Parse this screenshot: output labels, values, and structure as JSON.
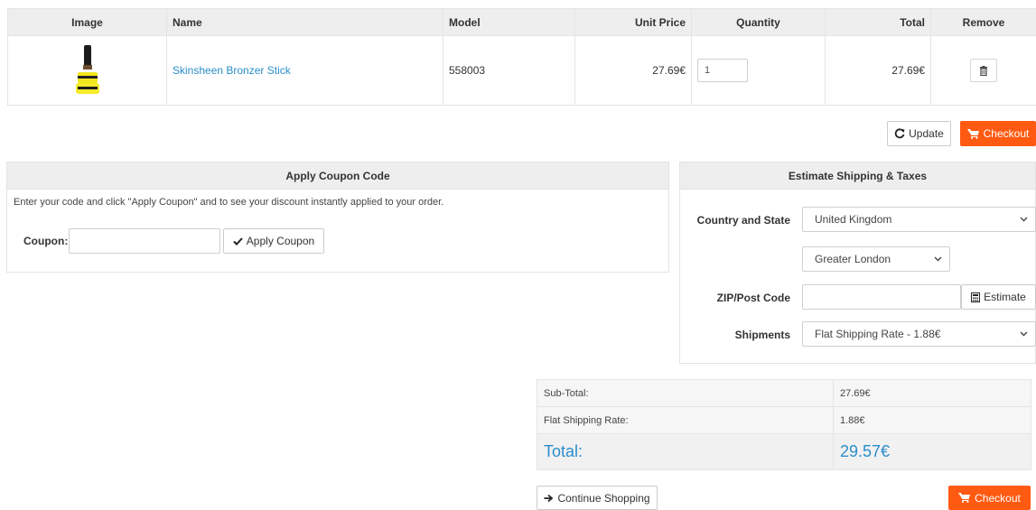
{
  "cart": {
    "headers": {
      "image": "Image",
      "name": "Name",
      "model": "Model",
      "unit_price": "Unit Price",
      "quantity": "Quantity",
      "total": "Total",
      "remove": "Remove"
    },
    "items": [
      {
        "name": "Skinsheen Bronzer Stick",
        "model": "558003",
        "unit_price": "27.69€",
        "quantity": "1",
        "total": "27.69€"
      }
    ],
    "update_label": "Update",
    "checkout_label": "Checkout"
  },
  "coupon": {
    "title": "Apply Coupon Code",
    "description": "Enter your code and click \"Apply Coupon\" and to see your discount instantly applied to your order.",
    "field_label": "Coupon:",
    "value": "",
    "button_label": "Apply Coupon"
  },
  "shipping": {
    "title": "Estimate Shipping & Taxes",
    "country_label": "Country and State",
    "country_value": "United Kingdom",
    "state_value": "Greater London",
    "zip_label": "ZIP/Post Code",
    "zip_value": "",
    "estimate_label": "Estimate",
    "shipments_label": "Shipments",
    "shipments_value": "Flat Shipping Rate - 1.88€"
  },
  "totals": {
    "subtotal_label": "Sub-Total:",
    "subtotal_value": "27.69€",
    "shipping_label": "Flat Shipping Rate:",
    "shipping_value": "1.88€",
    "total_label": "Total:",
    "total_value": "29.57€"
  },
  "footer": {
    "continue_label": "Continue Shopping",
    "checkout_label": "Checkout"
  },
  "colors": {
    "accent": "#ff5a11",
    "link": "#2a8ecb",
    "header_bg": "#eeeeee"
  }
}
